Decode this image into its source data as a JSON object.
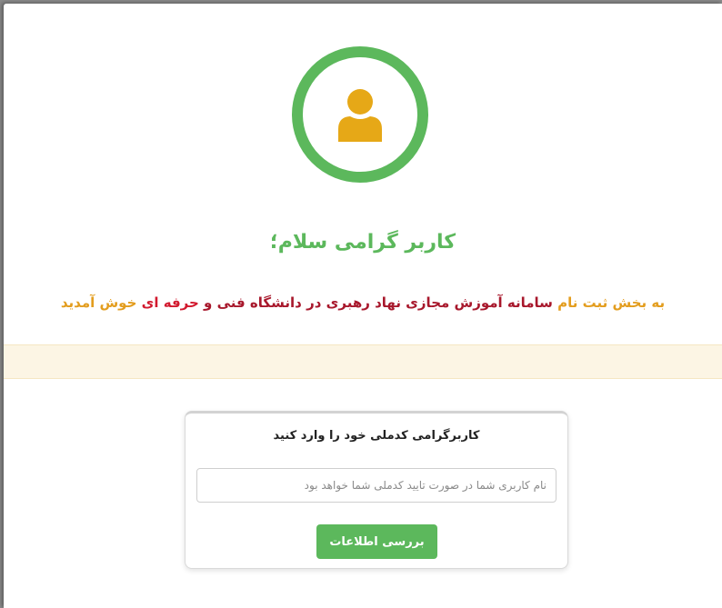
{
  "avatar": {
    "icon": "user-icon",
    "ring_color": "#5cb85c",
    "icon_color": "#e6a817"
  },
  "greeting": {
    "text": "کاربر گرامی سلام؛"
  },
  "welcome": {
    "part1": "به بخش ثبت نام ",
    "part2": "سامانه آموزش مجازی نهاد رهبری در دانشگاه فنی و ",
    "part3": "حرفه ای",
    "part4": " خوش آمدید"
  },
  "colors": {
    "green": "#5cb85c",
    "orange": "#e39d1e",
    "dark_red": "#a8182c",
    "red": "#d21a2f",
    "alert_bg": "#fcf5e4"
  },
  "form": {
    "title": "کاربرگرامی کدملی خود را وارد کنید",
    "input_placeholder": "نام کاربری شما در صورت تایید کدملی شما خواهد بود",
    "input_value": "",
    "submit_label": "بررسی اطلاعات"
  }
}
